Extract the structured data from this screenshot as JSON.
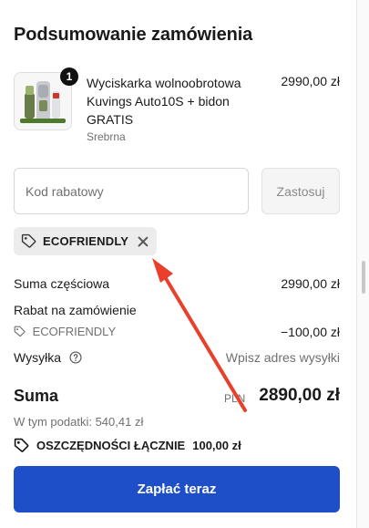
{
  "summary": {
    "title": "Podsumowanie zamówienia"
  },
  "product": {
    "quantity": "1",
    "name": "Wyciskarka wolnoobrotowa Kuvings Auto10S + bidon GRATIS",
    "variant": "Srebrna",
    "price": "2990,00 zł"
  },
  "discount": {
    "placeholder": "Kod rabatowy",
    "apply_label": "Zastosuj",
    "applied_code": "ECOFRIENDLY"
  },
  "lines": {
    "subtotal_label": "Suma częściowa",
    "subtotal_value": "2990,00 zł",
    "order_discount_label": "Rabat na zamówienie",
    "discount_code": "ECOFRIENDLY",
    "discount_value": "−100,00 zł",
    "shipping_label": "Wysyłka",
    "shipping_value": "Wpisz adres wysyłki"
  },
  "total": {
    "label": "Suma",
    "currency": "PLN",
    "value": "2890,00 zł",
    "tax_note": "W tym podatki: 540,41 zł"
  },
  "savings": {
    "label": "OSZCZĘDNOŚCI ŁĄCZNIE",
    "value": "100,00 zł"
  },
  "pay": {
    "label": "Zapłać teraz"
  },
  "colors": {
    "accent": "#1f4fc8",
    "annotation_arrow": "#e8402a"
  },
  "icons": [
    "tag-icon",
    "close-icon",
    "help-icon",
    "savings-tag-icon",
    "annotation-arrow"
  ]
}
